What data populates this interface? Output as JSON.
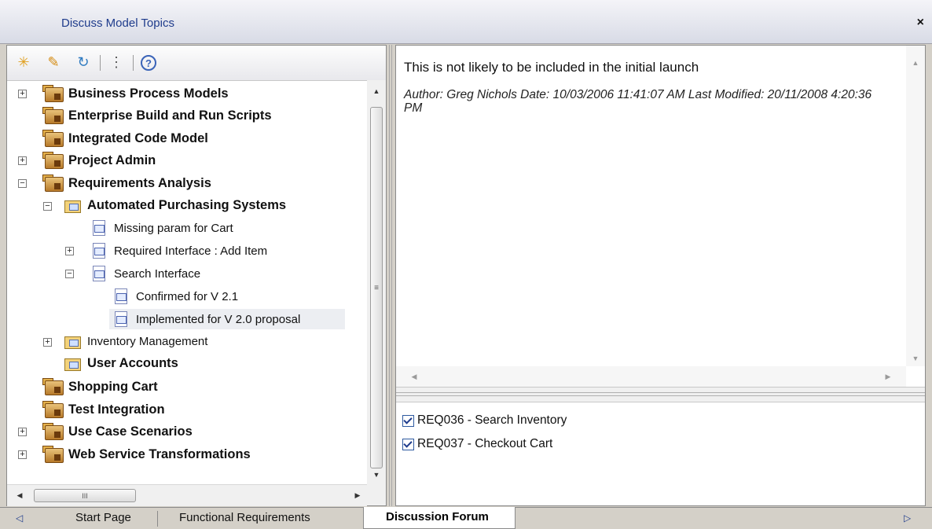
{
  "window": {
    "title": "Discuss Model Topics",
    "close_label": "×"
  },
  "toolbar": {
    "buttons": [
      {
        "icon": "new-topic-icon",
        "glyph": "✳"
      },
      {
        "icon": "edit-pencil-icon",
        "glyph": "✎"
      },
      {
        "icon": "refresh-icon",
        "glyph": "↻"
      },
      {
        "icon": "collapse-tree-icon",
        "glyph": "⋮"
      },
      {
        "icon": "help-icon",
        "glyph": "?"
      }
    ]
  },
  "tree": {
    "items": [
      {
        "label": "Business Process Models",
        "expander": "+"
      },
      {
        "label": "Enterprise Build and Run Scripts",
        "expander": ""
      },
      {
        "label": "Integrated Code Model",
        "expander": ""
      },
      {
        "label": "Project Admin",
        "expander": "+"
      },
      {
        "label": "Requirements Analysis",
        "expander": "−"
      },
      {
        "label": "Automated Purchasing Systems",
        "expander": "−"
      },
      {
        "label": "Missing param for Cart",
        "expander": ""
      },
      {
        "label": "Required Interface : Add Item",
        "expander": "+"
      },
      {
        "label": "Search Interface",
        "expander": "−"
      },
      {
        "label": "Confirmed for V 2.1",
        "expander": ""
      },
      {
        "label": "Implemented for V 2.0 proposal",
        "expander": "",
        "selected": true
      },
      {
        "label": "Inventory Management",
        "expander": "+"
      },
      {
        "label": "User Accounts",
        "expander": ""
      },
      {
        "label": "Shopping Cart",
        "expander": ""
      },
      {
        "label": "Test Integration",
        "expander": ""
      },
      {
        "label": "Use Case Scenarios",
        "expander": "+"
      },
      {
        "label": "Web Service Transformations",
        "expander": "+"
      }
    ],
    "scroll_grip": "≡",
    "hscroll_grip": "III"
  },
  "message": {
    "body": "This is not likely to be included in the initial launch",
    "meta": "Author: Greg Nichols        Date: 10/03/2006 11:41:07 AM        Last Modified: 20/11/2008 4:20:36 PM"
  },
  "requirements": [
    {
      "label": "REQ036 - Search Inventory",
      "checked": true
    },
    {
      "label": "REQ037 - Checkout Cart",
      "checked": true
    }
  ],
  "tabs": {
    "items": [
      "Start Page",
      "Functional Requirements",
      "Discussion Forum"
    ],
    "active": "Discussion Forum"
  },
  "colors": {
    "title_text": "#1f3c8c",
    "background": "#d4d0c8",
    "package_icon": "#d49a44"
  }
}
